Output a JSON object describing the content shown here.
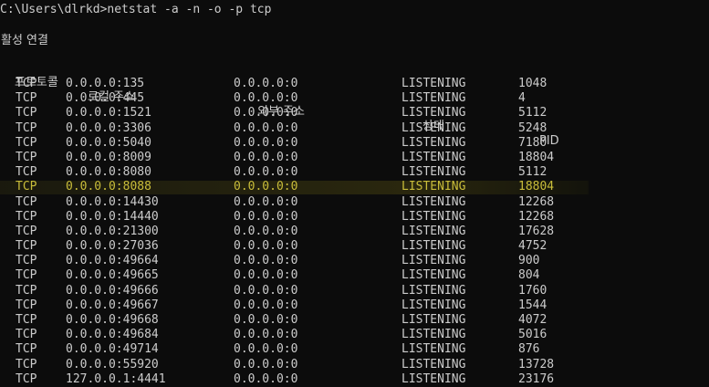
{
  "terminal": {
    "prompt": "C:\\Users\\dlrkd>",
    "command": "netstat -a -n -o -p tcp",
    "section_title": "활성 연결",
    "columns": {
      "proto": "프로토콜",
      "local": "로컬 주소",
      "foreign": "외부 주소",
      "state": "상태",
      "pid": "PID"
    },
    "highlight_color": "#c9bd3a",
    "rows": [
      {
        "proto": "TCP",
        "local": "0.0.0.0:135",
        "foreign": "0.0.0.0:0",
        "state": "LISTENING",
        "pid": "1048"
      },
      {
        "proto": "TCP",
        "local": "0.0.0.0:445",
        "foreign": "0.0.0.0:0",
        "state": "LISTENING",
        "pid": "4"
      },
      {
        "proto": "TCP",
        "local": "0.0.0.0:1521",
        "foreign": "0.0.0.0:0",
        "state": "LISTENING",
        "pid": "5112"
      },
      {
        "proto": "TCP",
        "local": "0.0.0.0:3306",
        "foreign": "0.0.0.0:0",
        "state": "LISTENING",
        "pid": "5248"
      },
      {
        "proto": "TCP",
        "local": "0.0.0.0:5040",
        "foreign": "0.0.0.0:0",
        "state": "LISTENING",
        "pid": "7180"
      },
      {
        "proto": "TCP",
        "local": "0.0.0.0:8009",
        "foreign": "0.0.0.0:0",
        "state": "LISTENING",
        "pid": "18804"
      },
      {
        "proto": "TCP",
        "local": "0.0.0.0:8080",
        "foreign": "0.0.0.0:0",
        "state": "LISTENING",
        "pid": "5112"
      },
      {
        "proto": "TCP",
        "local": "0.0.0.0:8088",
        "foreign": "0.0.0.0:0",
        "state": "LISTENING",
        "pid": "18804",
        "highlighted": true
      },
      {
        "proto": "TCP",
        "local": "0.0.0.0:14430",
        "foreign": "0.0.0.0:0",
        "state": "LISTENING",
        "pid": "12268"
      },
      {
        "proto": "TCP",
        "local": "0.0.0.0:14440",
        "foreign": "0.0.0.0:0",
        "state": "LISTENING",
        "pid": "12268"
      },
      {
        "proto": "TCP",
        "local": "0.0.0.0:21300",
        "foreign": "0.0.0.0:0",
        "state": "LISTENING",
        "pid": "17628"
      },
      {
        "proto": "TCP",
        "local": "0.0.0.0:27036",
        "foreign": "0.0.0.0:0",
        "state": "LISTENING",
        "pid": "4752"
      },
      {
        "proto": "TCP",
        "local": "0.0.0.0:49664",
        "foreign": "0.0.0.0:0",
        "state": "LISTENING",
        "pid": "900"
      },
      {
        "proto": "TCP",
        "local": "0.0.0.0:49665",
        "foreign": "0.0.0.0:0",
        "state": "LISTENING",
        "pid": "804"
      },
      {
        "proto": "TCP",
        "local": "0.0.0.0:49666",
        "foreign": "0.0.0.0:0",
        "state": "LISTENING",
        "pid": "1760"
      },
      {
        "proto": "TCP",
        "local": "0.0.0.0:49667",
        "foreign": "0.0.0.0:0",
        "state": "LISTENING",
        "pid": "1544"
      },
      {
        "proto": "TCP",
        "local": "0.0.0.0:49668",
        "foreign": "0.0.0.0:0",
        "state": "LISTENING",
        "pid": "4072"
      },
      {
        "proto": "TCP",
        "local": "0.0.0.0:49684",
        "foreign": "0.0.0.0:0",
        "state": "LISTENING",
        "pid": "5016"
      },
      {
        "proto": "TCP",
        "local": "0.0.0.0:49714",
        "foreign": "0.0.0.0:0",
        "state": "LISTENING",
        "pid": "876"
      },
      {
        "proto": "TCP",
        "local": "0.0.0.0:55920",
        "foreign": "0.0.0.0:0",
        "state": "LISTENING",
        "pid": "13728"
      },
      {
        "proto": "TCP",
        "local": "127.0.0.1:4441",
        "foreign": "0.0.0.0:0",
        "state": "LISTENING",
        "pid": "23176"
      }
    ]
  }
}
